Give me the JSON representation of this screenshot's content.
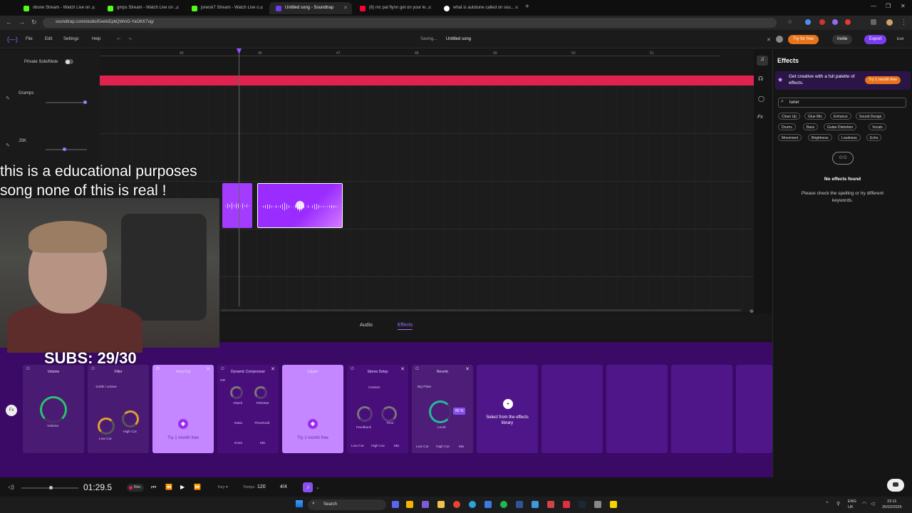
{
  "browser": {
    "tabs": [
      {
        "label": "vbone Stream - Watch Live on ...",
        "color": "#53fc18",
        "active": false
      },
      {
        "label": "gmps Stream - Watch Live on ...",
        "color": "#53fc18",
        "active": false
      },
      {
        "label": "jonesk7 Stream - Watch Live o...",
        "color": "#53fc18",
        "active": false
      },
      {
        "label": "Untitled song - Soundtrap",
        "color": "#6b3cf0",
        "active": true
      },
      {
        "label": "(6) mc pat flynn get on your le...",
        "color": "#ff0033",
        "active": false
      },
      {
        "label": "what is autotune called on sou...",
        "color": "#ffffff",
        "active": false
      }
    ],
    "url": "soundtrap.com/studio/EeeloEpbQWmD-YaOKK7og/"
  },
  "app": {
    "menu": [
      "File",
      "Edit",
      "Settings",
      "Help"
    ],
    "saving": "Saving...",
    "song_title": "Untitled song",
    "try_for_free": "Try for free",
    "invite": "Invite",
    "export": "Export",
    "exit": "Exit"
  },
  "tracks": {
    "private_solo": "Private Solo/Mute",
    "track1": "Gramps",
    "track2": "JSK",
    "ruler": [
      "45",
      "46",
      "47",
      "48",
      "49",
      "50",
      "51"
    ]
  },
  "effects_panel": {
    "title": "Effects",
    "promo": "Get creative with a full palette of effects.",
    "try_month": "Try 1 month free",
    "search_value": "tuner",
    "chips": [
      "Clean Up",
      "Glue Mix",
      "Enhance",
      "Sound Design",
      "Drums",
      "Bass",
      "Guitar Distortion",
      "Vocals",
      "Movement",
      "Brightness",
      "Loudness",
      "Echo"
    ],
    "no_results": "No effects found",
    "no_results_sub": "Please check the spelling or try different keywords."
  },
  "bottom": {
    "tab_audio": "Audio",
    "tab_effects": "Effects",
    "cards": {
      "volume": {
        "name": "Volume",
        "knob": "Volume"
      },
      "filter": {
        "name": "Filter",
        "preset": "-24dB / octave",
        "low": "Low Cut",
        "high": "High Cut"
      },
      "vocal_eq": {
        "name": "Vocal EQ",
        "try": "Try 1 month free"
      },
      "comp": {
        "name": "Dynamic Compressor",
        "gr": "GR",
        "attack": "Attack",
        "release": "Release",
        "ratio": "Ratio",
        "threshold": "Threshold",
        "knee": "Knee",
        "mix": "Mix"
      },
      "clipper": {
        "name": "Clipper",
        "try": "Try 1 month free"
      },
      "delay": {
        "name": "Stereo Delay",
        "preset": "Custom",
        "feedback": "Feedback",
        "time": "Time",
        "low": "Low Cut",
        "high": "High Cut",
        "mix": "Mix"
      },
      "reverb": {
        "name": "Reverb",
        "preset": "Big Plate",
        "level": "Level",
        "value": "85 %",
        "low": "Low Cut",
        "high": "High Cut",
        "mix": "Mix"
      },
      "select": "Select from the effects library"
    }
  },
  "transport": {
    "time": "01:29.5",
    "rec": "Rec",
    "key": "Key",
    "tempo_label": "Tempo",
    "tempo": "120",
    "signature": "4/4"
  },
  "taskbar": {
    "search": "Search",
    "lang1": "ENG",
    "lang2": "UK",
    "time": "23:11",
    "date": "26/02/2026"
  },
  "overlay": {
    "line1": "this is a educational purposes",
    "line2": "song none of this is real !",
    "subs": "SUBS: 29/30"
  }
}
